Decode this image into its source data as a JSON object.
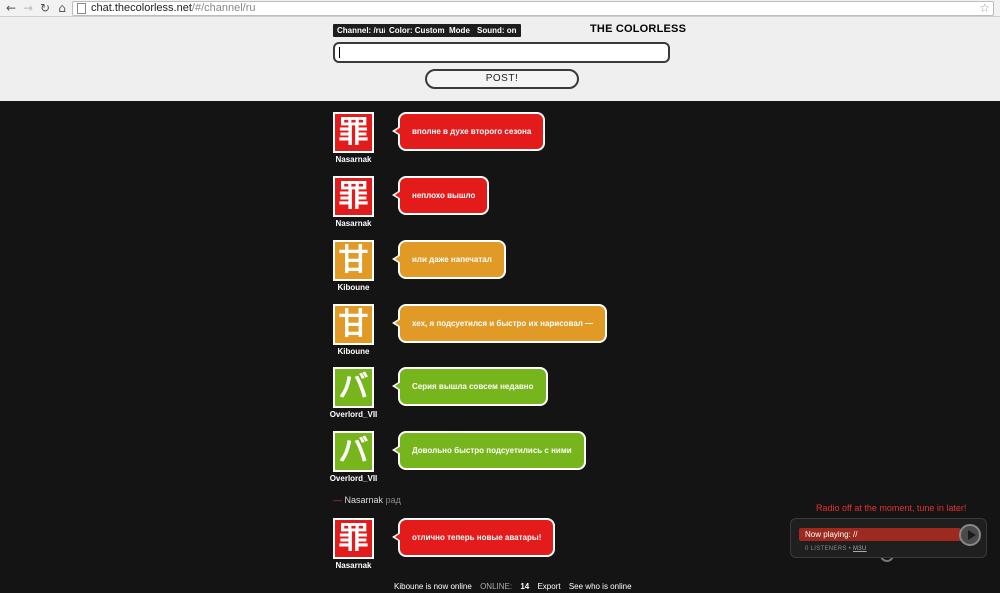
{
  "browser": {
    "url_host": "chat.thecolorless.net",
    "url_path": "/#/channel/ru",
    "back_icon": "back-arrow-icon",
    "forward_icon": "forward-arrow-icon",
    "reload_icon": "reload-icon",
    "home_icon": "home-icon",
    "bookmark_icon": "star-icon"
  },
  "header": {
    "channel_chip": "Channel: /ru/",
    "color_chip": "Color: Custom",
    "mode_chip": "Mode",
    "sound_chip": "Sound: on",
    "logo": "THE COLORLESS",
    "input_value": "",
    "post_label": "POST!"
  },
  "messages": [
    {
      "user": "Nasarnak",
      "glyph": "罪",
      "color": "#e31b1b",
      "text": "вполне в духе второго сезона"
    },
    {
      "user": "Nasarnak",
      "glyph": "罪",
      "color": "#e31b1b",
      "text": "неплохо вышло"
    },
    {
      "user": "Kiboune",
      "glyph": "甘",
      "color": "#e09a25",
      "text": "или даже напечатал"
    },
    {
      "user": "Kiboune",
      "glyph": "甘",
      "color": "#e09a25",
      "text": "хех, я подсуетился и быстро их нарисовал —"
    },
    {
      "user": "Overlord_VII",
      "glyph": "バ",
      "color": "#76b51b",
      "text": "Серия вышла совсем недавно"
    },
    {
      "user": "Overlord_VII",
      "glyph": "バ",
      "color": "#76b51b",
      "text": "Довольно быстро подсуетились с ними"
    },
    {
      "user": "Nasarnak",
      "glyph": "罪",
      "color": "#e31b1b",
      "text": "отлично теперь новые аватары!"
    }
  ],
  "emote": {
    "dash": "—",
    "user": "Nasarnak",
    "action": "рад"
  },
  "footer": {
    "status": "Kiboune is now online",
    "online_label": "ONLINE:",
    "online_count": "14",
    "export_label": "Export",
    "who_label": "See who is online"
  },
  "radio": {
    "message": "Radio off at the moment, tune in later!",
    "now_playing": "Now playing: //",
    "listeners": "0 LISTENERS",
    "separator": "•",
    "m3u": "M3U",
    "play_icon": "play-icon"
  }
}
